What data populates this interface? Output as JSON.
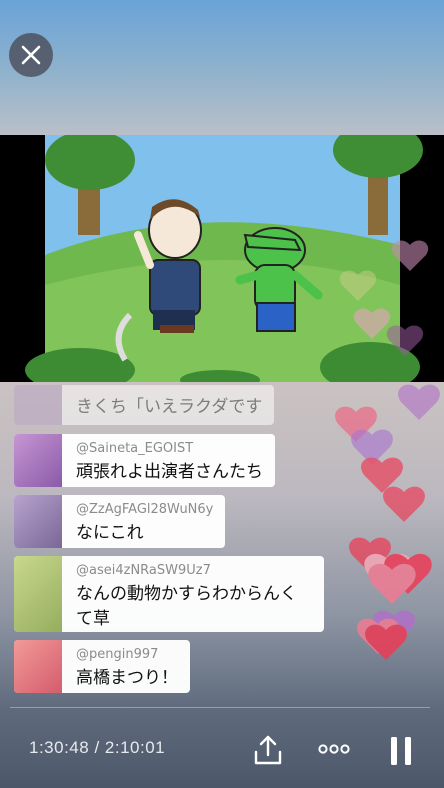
{
  "player": {
    "time_display": "1:30:48 / 2:10:01",
    "progress": 0.698
  },
  "icons": {
    "close": "close-icon",
    "share": "share-icon",
    "more": "more-icon",
    "pause": "pause-icon"
  },
  "comments": [
    {
      "user": "",
      "message": "きくち「いえラクダです",
      "avatar_color": "#bba6c4"
    },
    {
      "user": "@Saineta_EGOIST",
      "message": "頑張れよ出演者さんたち",
      "avatar_color": "#b07fc2"
    },
    {
      "user": "@ZzAgFAGl28WuN6y",
      "message": "なにこれ",
      "avatar_color": "#9b86b8"
    },
    {
      "user": "@asei4zNRaSW9Uz7",
      "message": "なんの動物かすらわからんくて草",
      "avatar_color": "#b3c77a"
    },
    {
      "user": "@pengin997",
      "message": "高橋まつり！",
      "avatar_color": "#e07f85"
    }
  ],
  "colors": {
    "heart_pink": "#f06080",
    "heart_purple": "#b070c8",
    "heart_red": "#ec3b55"
  }
}
